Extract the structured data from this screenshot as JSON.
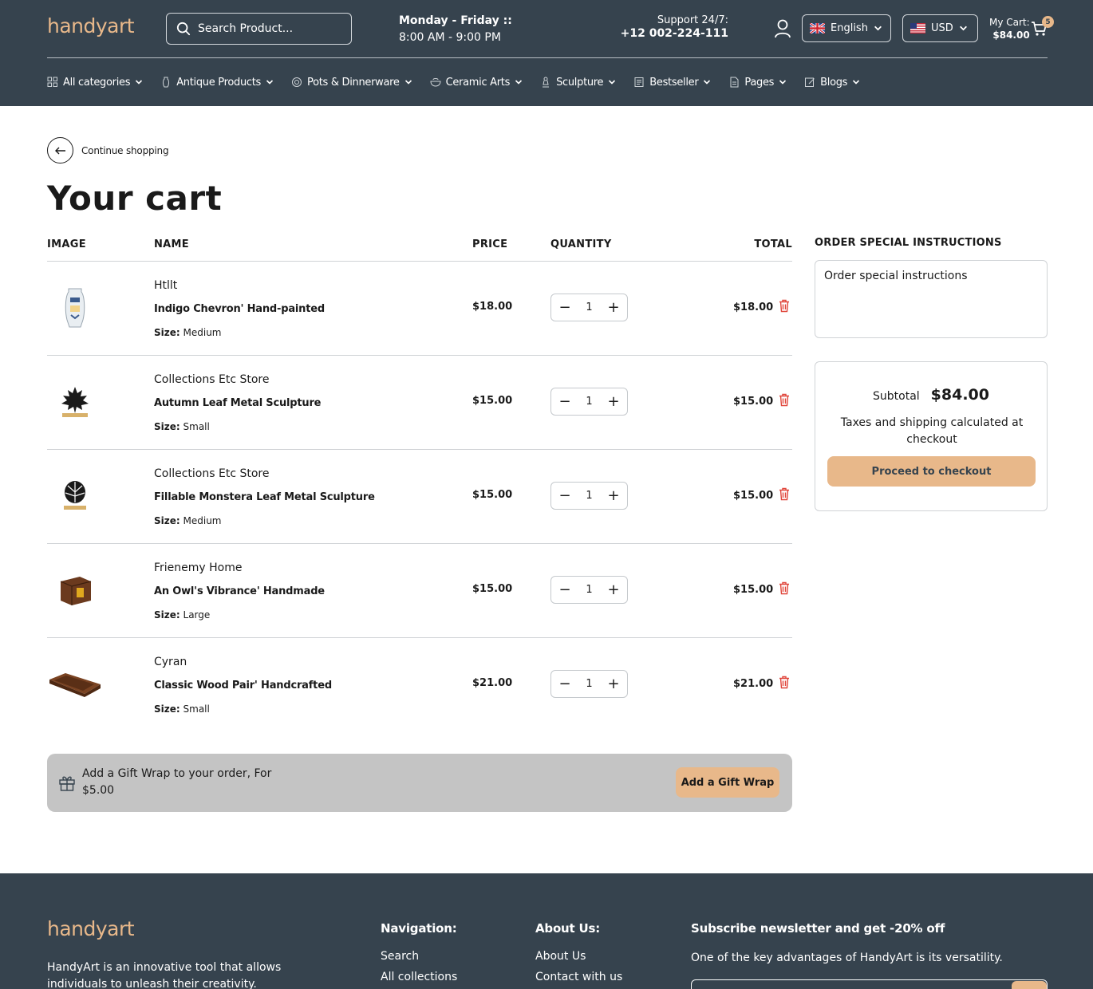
{
  "header": {
    "logo": "handyart",
    "search_placeholder": "Search Product...",
    "hours_line1": "Monday - Friday ::",
    "hours_line2": "8:00 AM - 9:00 PM",
    "support_label": "Support 24/7:",
    "support_phone": "+12 002-224-111",
    "language": "English",
    "currency": "USD",
    "cart_label": "My Cart:",
    "cart_amount": "$84.00",
    "cart_count": "5"
  },
  "nav": [
    {
      "label": "All categories",
      "icon": "grid-icon"
    },
    {
      "label": "Antique Products",
      "icon": "vase-icon"
    },
    {
      "label": "Pots & Dinnerware",
      "icon": "pot-icon"
    },
    {
      "label": "Ceramic Arts",
      "icon": "bowl-icon"
    },
    {
      "label": "Sculpture",
      "icon": "sculpture-icon"
    },
    {
      "label": "Bestseller",
      "icon": "book-icon"
    },
    {
      "label": "Pages",
      "icon": "page-icon"
    },
    {
      "label": "Blogs",
      "icon": "blog-icon"
    }
  ],
  "page": {
    "back_label": "Continue shopping",
    "title": "Your cart"
  },
  "table": {
    "headers": {
      "image": "IMAGE",
      "name": "NAME",
      "price": "PRICE",
      "quantity": "QUANTITY",
      "total": "TOTAL"
    },
    "size_label": "Size:",
    "rows": [
      {
        "vendor": "Htllt",
        "name": "Indigo Chevron' Hand-painted",
        "size": "Medium",
        "price": "$18.00",
        "qty": "1",
        "total": "$18.00",
        "thumb": "vase-product"
      },
      {
        "vendor": "Collections Etc Store",
        "name": "Autumn Leaf Metal Sculpture",
        "size": "Small",
        "price": "$15.00",
        "qty": "1",
        "total": "$15.00",
        "thumb": "maple-leaf-product"
      },
      {
        "vendor": "Collections Etc Store",
        "name": "Fillable Monstera Leaf Metal Sculpture",
        "size": "Medium",
        "price": "$15.00",
        "qty": "1",
        "total": "$15.00",
        "thumb": "monstera-leaf-product"
      },
      {
        "vendor": "Frienemy Home",
        "name": "An Owl's Vibrance' Handmade",
        "size": "Large",
        "price": "$15.00",
        "qty": "1",
        "total": "$15.00",
        "thumb": "wooden-box-product"
      },
      {
        "vendor": "Cyran",
        "name": "Classic Wood Pair' Handcrafted",
        "size": "Small",
        "price": "$21.00",
        "qty": "1",
        "total": "$21.00",
        "thumb": "wood-tray-product"
      }
    ]
  },
  "gift": {
    "line1": "Add a Gift Wrap to your order, For",
    "line2": "$5.00",
    "button": "Add a Gift Wrap"
  },
  "sidebar": {
    "instructions_title": "ORDER SPECIAL INSTRUCTIONS",
    "instructions_placeholder": "Order special instructions",
    "subtotal_label": "Subtotal",
    "subtotal_amount": "$84.00",
    "taxes_note": "Taxes and shipping calculated at checkout",
    "checkout_button": "Proceed to checkout"
  },
  "footer": {
    "logo": "handyart",
    "description": "HandyArt is an innovative tool that allows individuals to unleash their creativity.",
    "nav_title": "Navigation:",
    "nav_links": [
      "Search",
      "All collections"
    ],
    "about_title": "About Us:",
    "about_links": [
      "About Us",
      "Contact with us"
    ],
    "subscribe_title": "Subscribe newsletter and get -20% off",
    "subscribe_text": "One of the key advantages of HandyArt is its versatility."
  },
  "colors": {
    "header_bg": "#36434e",
    "accent": "#e8b88a",
    "trash": "#e0453a",
    "gift_bg": "#c4c4c4"
  }
}
